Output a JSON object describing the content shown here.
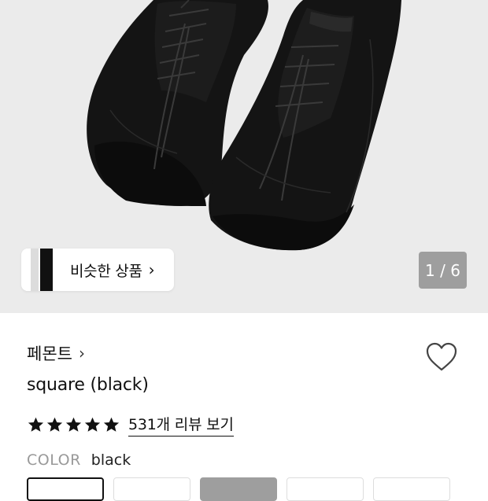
{
  "gallery": {
    "counter": "1 / 6",
    "similar_label": "비슷한 상품"
  },
  "product": {
    "brand": "페몬트",
    "name": "square (black)",
    "rating": 5,
    "review_link": "531개 리뷰 보기",
    "color_label": "COLOR",
    "color_value": "black"
  },
  "colors": {
    "hero_bg": "#ebebeb",
    "counter_bg": "#9e9e9e"
  }
}
